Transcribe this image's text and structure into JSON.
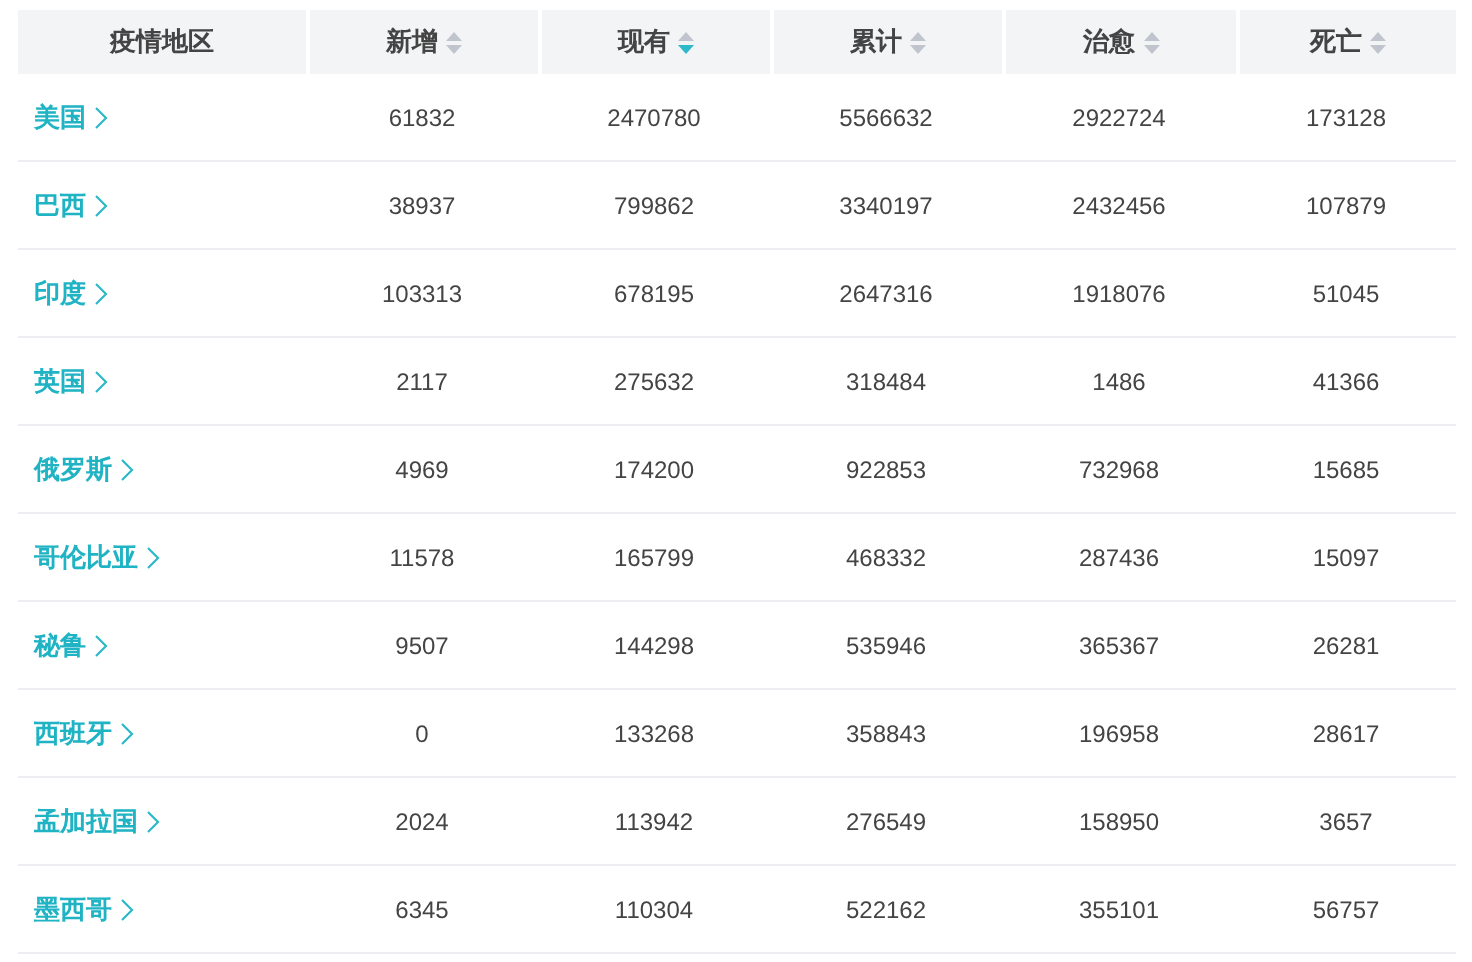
{
  "table": {
    "columns": [
      {
        "label": "疫情地区",
        "sortable": false
      },
      {
        "label": "新增",
        "sortable": true,
        "sorted": false
      },
      {
        "label": "现有",
        "sortable": true,
        "sorted": true
      },
      {
        "label": "累计",
        "sortable": true,
        "sorted": false
      },
      {
        "label": "治愈",
        "sortable": true,
        "sorted": false
      },
      {
        "label": "死亡",
        "sortable": true,
        "sorted": false
      }
    ],
    "rows": [
      {
        "region": "美国",
        "values": [
          "61832",
          "2470780",
          "5566632",
          "2922724",
          "173128"
        ]
      },
      {
        "region": "巴西",
        "values": [
          "38937",
          "799862",
          "3340197",
          "2432456",
          "107879"
        ]
      },
      {
        "region": "印度",
        "values": [
          "103313",
          "678195",
          "2647316",
          "1918076",
          "51045"
        ]
      },
      {
        "region": "英国",
        "values": [
          "2117",
          "275632",
          "318484",
          "1486",
          "41366"
        ]
      },
      {
        "region": "俄罗斯",
        "values": [
          "4969",
          "174200",
          "922853",
          "732968",
          "15685"
        ]
      },
      {
        "region": "哥伦比亚",
        "values": [
          "11578",
          "165799",
          "468332",
          "287436",
          "15097"
        ]
      },
      {
        "region": "秘鲁",
        "values": [
          "9507",
          "144298",
          "535946",
          "365367",
          "26281"
        ]
      },
      {
        "region": "西班牙",
        "values": [
          "0",
          "133268",
          "358843",
          "196958",
          "28617"
        ]
      },
      {
        "region": "孟加拉国",
        "values": [
          "2024",
          "113942",
          "276549",
          "158950",
          "3657"
        ]
      },
      {
        "region": "墨西哥",
        "values": [
          "6345",
          "110304",
          "522162",
          "355101",
          "56757"
        ]
      }
    ]
  }
}
